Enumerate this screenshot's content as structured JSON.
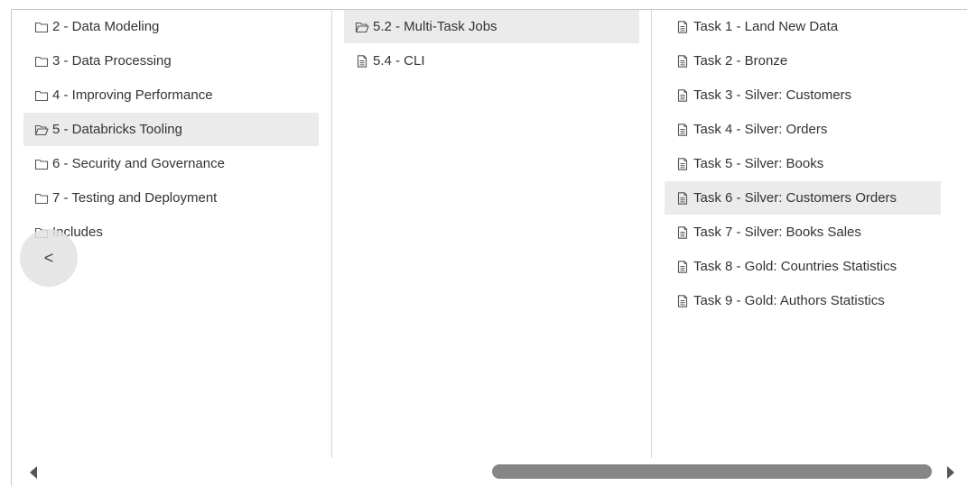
{
  "columns": [
    {
      "items": [
        {
          "label": "2 - Data Modeling",
          "icon": "folder-icon",
          "selected": false
        },
        {
          "label": "3 - Data Processing",
          "icon": "folder-icon",
          "selected": false
        },
        {
          "label": "4 - Improving Performance",
          "icon": "folder-icon",
          "selected": false
        },
        {
          "label": "5 - Databricks Tooling",
          "icon": "folder-open-icon",
          "selected": true
        },
        {
          "label": "6 - Security and Governance",
          "icon": "folder-icon",
          "selected": false
        },
        {
          "label": "7 - Testing and Deployment",
          "icon": "folder-icon",
          "selected": false
        },
        {
          "label": "Includes",
          "icon": "folder-icon",
          "selected": false
        }
      ]
    },
    {
      "items": [
        {
          "label": "5.2 - Multi-Task Jobs",
          "icon": "folder-open-icon",
          "selected": true
        },
        {
          "label": "5.4 - CLI",
          "icon": "notebook-icon",
          "selected": false
        }
      ]
    },
    {
      "items": [
        {
          "label": "Task 1 - Land New Data",
          "icon": "notebook-icon",
          "selected": false
        },
        {
          "label": "Task 2 - Bronze",
          "icon": "notebook-icon",
          "selected": false
        },
        {
          "label": "Task 3 - Silver: Customers",
          "icon": "notebook-icon",
          "selected": false
        },
        {
          "label": "Task 4 - Silver: Orders",
          "icon": "notebook-icon",
          "selected": false
        },
        {
          "label": "Task 5 - Silver: Books",
          "icon": "notebook-icon",
          "selected": false
        },
        {
          "label": "Task 6 - Silver: Customers Orders",
          "icon": "notebook-icon",
          "selected": true
        },
        {
          "label": "Task 7 - Silver: Books Sales",
          "icon": "notebook-icon",
          "selected": false
        },
        {
          "label": "Task 8 - Gold: Countries Statistics",
          "icon": "notebook-icon",
          "selected": false
        },
        {
          "label": "Task 9 - Gold: Authors Statistics",
          "icon": "notebook-icon",
          "selected": false
        }
      ]
    }
  ],
  "back_button": {
    "glyph": "<",
    "icon": "chevron-left-icon"
  },
  "colors": {
    "selected_bg": "#ebebeb",
    "text": "#333333",
    "scroll_thumb": "#868686"
  }
}
